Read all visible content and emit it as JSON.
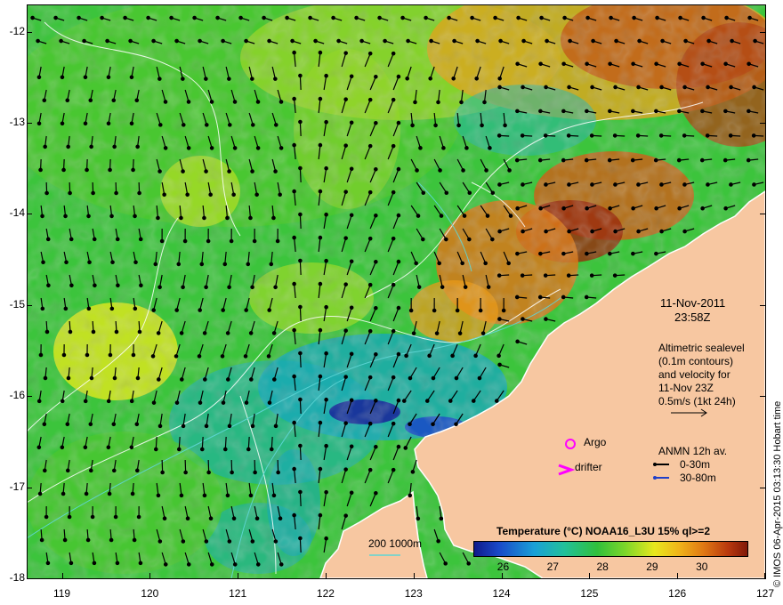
{
  "axes": {
    "lon_ticks": [
      "119",
      "120",
      "121",
      "122",
      "123",
      "124",
      "125",
      "126",
      "127"
    ],
    "lat_ticks": [
      "-12",
      "-13",
      "-14",
      "-15",
      "-16",
      "-17",
      "-18"
    ],
    "lon_range": [
      118.6,
      127.0
    ],
    "lat_range": [
      -18.0,
      -11.7
    ]
  },
  "timestamp": {
    "date": "11-Nov-2011",
    "time": "23:58Z"
  },
  "altimetry_note": {
    "line1": "Altimetric sealevel",
    "line2": "(0.1m contours)",
    "line3": "and velocity for",
    "line4": "11-Nov 23Z",
    "line5": "0.5m/s (1kt 24h)"
  },
  "legend": {
    "argo_label": "Argo",
    "drifter_label": "drifter",
    "anmn_title": "ANMN 12h av.",
    "anmn_shallow": "0-30m",
    "anmn_deep": "30-80m",
    "depth_contours": "200  1000m"
  },
  "colorbar": {
    "title": "Temperature (°C) NOAA16_L3U 15% ql>=2",
    "labels": [
      "26",
      "27",
      "28",
      "29",
      "30"
    ],
    "range": [
      25.4,
      30.9
    ]
  },
  "credit": "© IMOS 06-Apr-2015 03:13:30 Hobart time",
  "colors": {
    "land": "#f7c7a1",
    "coast": "#ffffff",
    "argo": "#ff00ff",
    "drifter": "#ff00ff",
    "anmn_shallow": "#000000",
    "anmn_deep": "#1f3fc8",
    "sst_cool": "#18a9b8",
    "sst_green": "#35c23a",
    "sst_yellow": "#d8e61e",
    "sst_warm": "#e0781a",
    "sst_hot": "#9a2a0e"
  }
}
